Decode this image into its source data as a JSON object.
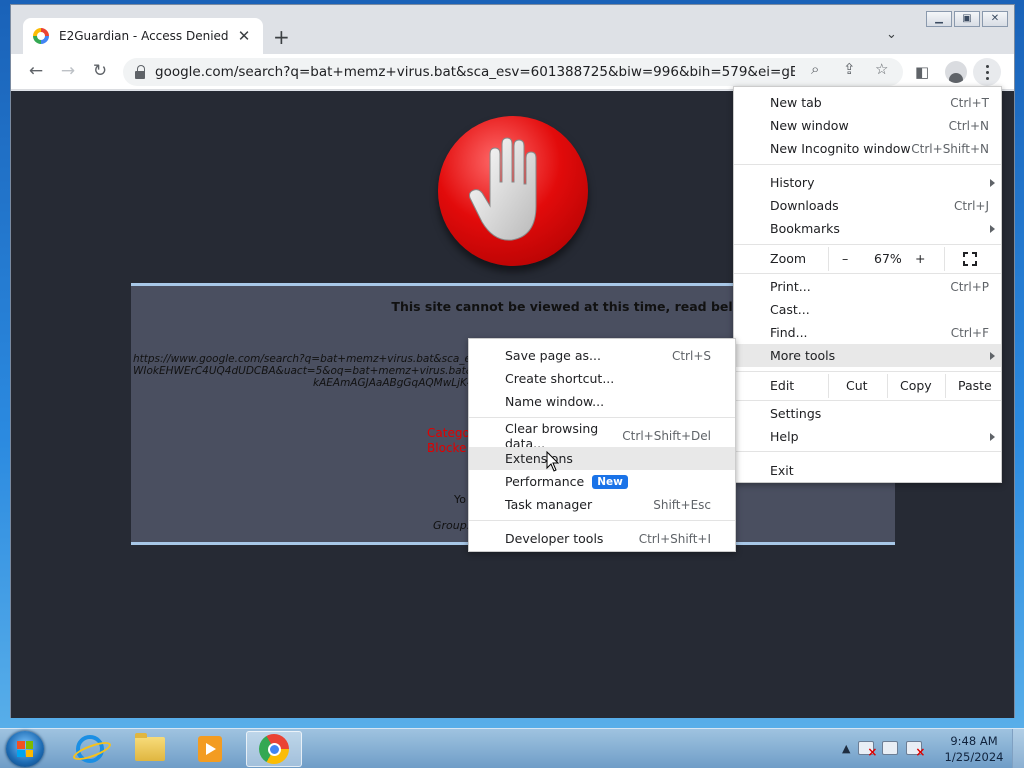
{
  "browser": {
    "tab_title": "E2Guardian - Access Denied",
    "address_url": "google.com/search?q=bat+memz+virus.bat&sca_esv=601388725&biw=996&bih=579&ei=gEqyZe7rB..."
  },
  "page": {
    "heading": "This site cannot be viewed at this time, read below for details:",
    "blocked_url_lines": [
      "https://www.google.com/search?q=bat+memz+virus.bat&sca_esv=60",
      "WIokEHWErC4UQ4dUDCBA&uact=5&oq=bat+memz+virus.bat&gs_lp=Eg",
      "kAEAmAGJAaABgGqAQMwLjK4"
    ],
    "category_lines": [
      "Catego",
      "Blocke"
    ],
    "your_text": "Yo",
    "group_text": "Group:"
  },
  "menu": {
    "items": [
      {
        "label": "New tab",
        "shortcut": "Ctrl+T"
      },
      {
        "label": "New window",
        "shortcut": "Ctrl+N"
      },
      {
        "label": "New Incognito window",
        "shortcut": "Ctrl+Shift+N"
      },
      {
        "label": "History",
        "shortcut": ""
      },
      {
        "label": "Downloads",
        "shortcut": "Ctrl+J"
      },
      {
        "label": "Bookmarks",
        "shortcut": ""
      },
      {
        "label": "Print...",
        "shortcut": "Ctrl+P"
      },
      {
        "label": "Cast...",
        "shortcut": ""
      },
      {
        "label": "Find...",
        "shortcut": "Ctrl+F"
      },
      {
        "label": "More tools",
        "shortcut": ""
      },
      {
        "label": "Settings",
        "shortcut": ""
      },
      {
        "label": "Help",
        "shortcut": ""
      },
      {
        "label": "Exit",
        "shortcut": ""
      }
    ],
    "zoom": {
      "label": "Zoom",
      "minus": "–",
      "value": "67%",
      "plus": "+"
    },
    "edit": {
      "label": "Edit",
      "cut": "Cut",
      "copy": "Copy",
      "paste": "Paste"
    }
  },
  "submenu": {
    "items": [
      {
        "label": "Save page as...",
        "shortcut": "Ctrl+S"
      },
      {
        "label": "Create shortcut...",
        "shortcut": ""
      },
      {
        "label": "Name window...",
        "shortcut": ""
      },
      {
        "label": "Clear browsing data...",
        "shortcut": "Ctrl+Shift+Del"
      },
      {
        "label": "Extensions",
        "shortcut": ""
      },
      {
        "label": "Performance",
        "shortcut": ""
      },
      {
        "label": "Task manager",
        "shortcut": "Shift+Esc"
      },
      {
        "label": "Developer tools",
        "shortcut": "Ctrl+Shift+I"
      }
    ],
    "new_badge": "New"
  },
  "taskbar": {
    "time": "9:48 AM",
    "date": "1/25/2024"
  },
  "colors": {
    "accent": "#1a73e8",
    "page_background": "#262a34",
    "block_box": "#4a4f60",
    "category_red": "#e00000"
  }
}
